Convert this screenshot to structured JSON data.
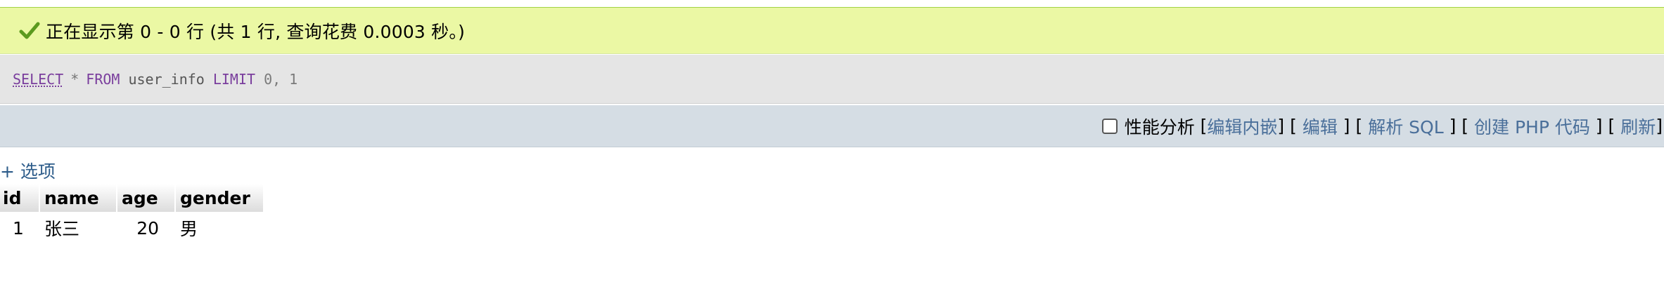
{
  "banner": {
    "message": "正在显示第 0 - 0 行 (共 1 行, 查询花费 0.0003 秒。)",
    "status_color": "#ebf8a4"
  },
  "sql": {
    "select": "SELECT",
    "star": "*",
    "from": "FROM",
    "table": "user_info",
    "limit": "LIMIT",
    "args": "0, 1"
  },
  "toolbar": {
    "profiling_label": "性能分析",
    "profiling_checked": false,
    "edit_inline": "编辑内嵌",
    "edit": "编辑",
    "explain_sql": "解析 SQL",
    "create_php": "创建 PHP 代码",
    "refresh": "刷新"
  },
  "options": {
    "label": "+ 选项"
  },
  "table": {
    "columns": [
      "id",
      "name",
      "age",
      "gender"
    ],
    "rows": [
      [
        "1",
        "张三",
        "20",
        "男"
      ]
    ]
  },
  "icons": {
    "success": "check-icon"
  }
}
